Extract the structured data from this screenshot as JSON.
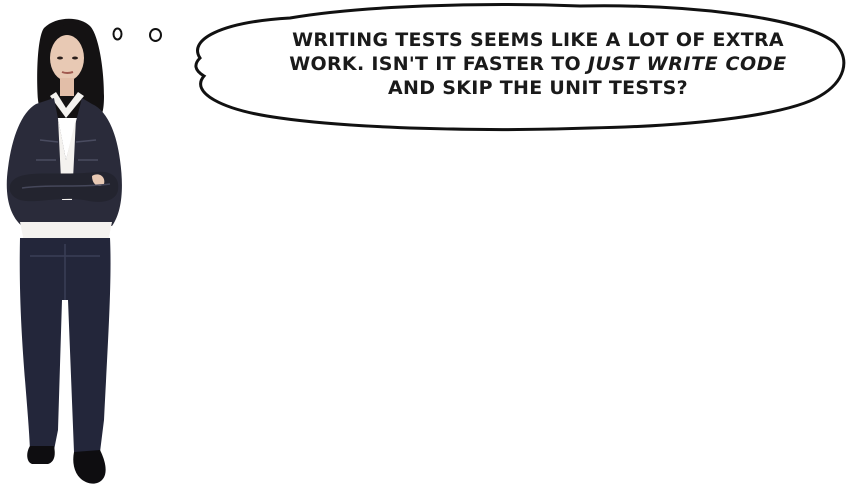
{
  "thought": {
    "line1": "Writing tests seems like a lot of extra",
    "line2_prefix": "work. Isn't it faster to ",
    "line2_emphasis": "just write code",
    "line3": "and skip the unit tests?"
  },
  "illustration": {
    "subject": "woman-arms-crossed",
    "jacket_color": "#2a2b3a",
    "jeans_color": "#23263a",
    "hair_color": "#141213",
    "skin_color": "#e8c9b4",
    "shirt_color": "#f4f2ef"
  },
  "bubble": {
    "fill": "#ffffff",
    "stroke": "#111111"
  }
}
